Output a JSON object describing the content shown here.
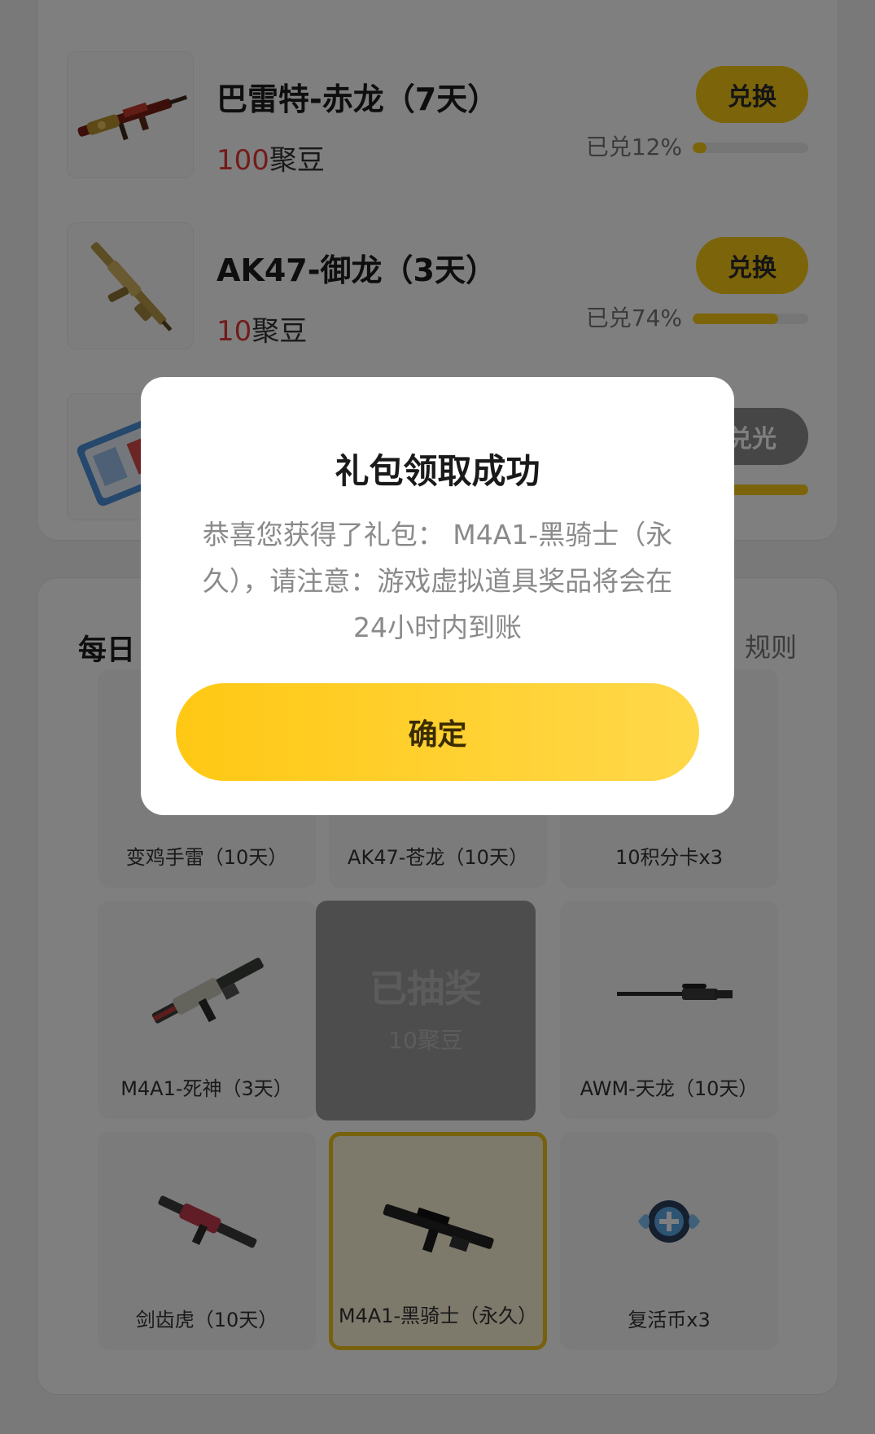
{
  "exchange": {
    "items": [
      {
        "name": "巴雷特-赤龙（7天）",
        "price": "100",
        "unit": "聚豆",
        "button": "兑换",
        "progress_label": "已兑12%",
        "progress": 0.12,
        "icon": "barrett-red-dragon-rifle-icon"
      },
      {
        "name": "AK47-御龙（3天）",
        "price": "10",
        "unit": "聚豆",
        "button": "兑换",
        "progress_label": "已兑74%",
        "progress": 0.74,
        "icon": "ak47-golden-dragon-icon"
      },
      {
        "name": "",
        "price": "",
        "unit": "",
        "button": "兑光",
        "progress_label": "",
        "progress": 1.0,
        "icon": "card-pack-icon"
      }
    ]
  },
  "daily": {
    "title": "每日",
    "rules_link": "规则",
    "grid": [
      {
        "label": "变鸡手雷（10天）",
        "icon": "chicken-grenade-icon"
      },
      {
        "label": "AK47-苍龙（10天）",
        "icon": "ak47-blue-dragon-icon"
      },
      {
        "label": "10积分卡x3",
        "icon": "points-card-icon"
      },
      {
        "label": "M4A1-死神（3天）",
        "icon": "m4a1-reaper-icon"
      },
      {
        "label": "AWM-天龙（10天）",
        "icon": "awm-sniper-icon"
      },
      {
        "label": "剑齿虎（10天）",
        "icon": "sabertooth-rifle-icon"
      },
      {
        "label": "M4A1-黑骑士（永久）",
        "icon": "m4a1-black-knight-icon"
      },
      {
        "label": "复活币x3",
        "icon": "revive-coin-icon"
      }
    ],
    "center": {
      "title": "已抽奖",
      "cost": "10聚豆"
    }
  },
  "modal": {
    "title": "礼包领取成功",
    "message": "恭喜您获得了礼包： M4A1-黑骑士（永久），请注意：游戏虚拟道具奖品将会在24小时内到账",
    "confirm": "确定"
  },
  "colors": {
    "accent": "#f9c914",
    "price": "#e53935",
    "overlay": "rgba(0,0,0,0.5)"
  }
}
